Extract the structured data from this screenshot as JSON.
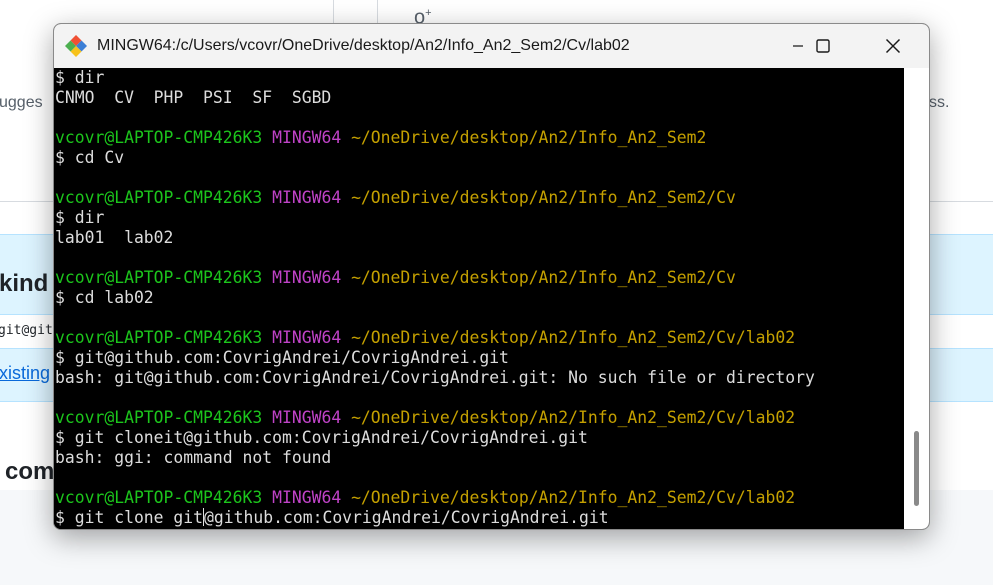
{
  "background": {
    "suggest_fragment": "ugges",
    "trailing_fragment": "ss.",
    "heading_kind": "kind o",
    "mono_fragment": "git@git",
    "link_existing": "xisting",
    "heading_com": "com"
  },
  "window": {
    "title": "MINGW64:/c/Users/vcovr/OneDrive/desktop/An2/Info_An2_Sem2/Cv/lab02",
    "controls": {
      "minimize_icon": "minimize-icon",
      "maximize_icon": "maximize-icon",
      "close_icon": "close-icon"
    }
  },
  "terminal": {
    "lines": [
      {
        "kind": "text",
        "text": "$ dir"
      },
      {
        "kind": "text",
        "text": "CNMO  CV  PHP  PSI  SF  SGBD"
      },
      {
        "kind": "text",
        "text": ""
      },
      {
        "kind": "prompt",
        "user": "vcovr@LAPTOP-CMP426K3",
        "system": "MINGW64",
        "path": "~/OneDrive/desktop/An2/Info_An2_Sem2"
      },
      {
        "kind": "text",
        "text": "$ cd Cv"
      },
      {
        "kind": "text",
        "text": ""
      },
      {
        "kind": "prompt",
        "user": "vcovr@LAPTOP-CMP426K3",
        "system": "MINGW64",
        "path": "~/OneDrive/desktop/An2/Info_An2_Sem2/Cv"
      },
      {
        "kind": "text",
        "text": "$ dir"
      },
      {
        "kind": "text",
        "text": "lab01  lab02"
      },
      {
        "kind": "text",
        "text": ""
      },
      {
        "kind": "prompt",
        "user": "vcovr@LAPTOP-CMP426K3",
        "system": "MINGW64",
        "path": "~/OneDrive/desktop/An2/Info_An2_Sem2/Cv"
      },
      {
        "kind": "text",
        "text": "$ cd lab02"
      },
      {
        "kind": "text",
        "text": ""
      },
      {
        "kind": "prompt",
        "user": "vcovr@LAPTOP-CMP426K3",
        "system": "MINGW64",
        "path": "~/OneDrive/desktop/An2/Info_An2_Sem2/Cv/lab02"
      },
      {
        "kind": "text",
        "text": "$ git@github.com:CovrigAndrei/CovrigAndrei.git"
      },
      {
        "kind": "text",
        "text": "bash: git@github.com:CovrigAndrei/CovrigAndrei.git: No such file or directory"
      },
      {
        "kind": "text",
        "text": ""
      },
      {
        "kind": "prompt",
        "user": "vcovr@LAPTOP-CMP426K3",
        "system": "MINGW64",
        "path": "~/OneDrive/desktop/An2/Info_An2_Sem2/Cv/lab02"
      },
      {
        "kind": "text",
        "text": "$ git cloneit@github.com:CovrigAndrei/CovrigAndrei.git"
      },
      {
        "kind": "text",
        "text": "bash: ggi: command not found"
      },
      {
        "kind": "text",
        "text": ""
      },
      {
        "kind": "prompt",
        "user": "vcovr@LAPTOP-CMP426K3",
        "system": "MINGW64",
        "path": "~/OneDrive/desktop/An2/Info_An2_Sem2/Cv/lab02"
      }
    ],
    "current_input_before_cursor": "$ git clone git",
    "current_input_after_cursor": "@github.com:CovrigAndrei/CovrigAndrei.git"
  },
  "colors": {
    "terminal_bg": "#000000",
    "prompt_user": "#1cc51c",
    "prompt_system": "#c043c8",
    "prompt_path": "#c4a000",
    "text": "#dcdcdc"
  }
}
